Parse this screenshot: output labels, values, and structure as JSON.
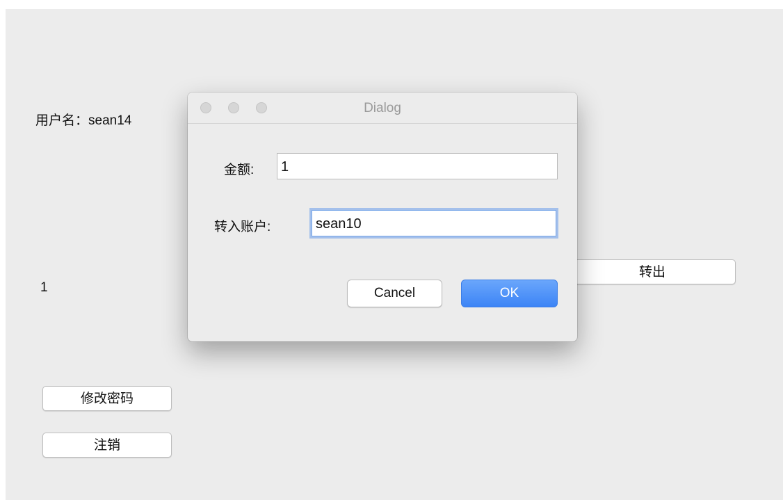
{
  "main": {
    "username_label": "用户名：sean14",
    "value_text": "1",
    "transfer_out_button": "转出",
    "change_password_button": "修改密码",
    "logout_button": "注销"
  },
  "dialog": {
    "title": "Dialog",
    "amount_label": "金额:",
    "amount_value": "1",
    "account_label": "转入账户:",
    "account_value": "sean10",
    "cancel_button": "Cancel",
    "ok_button": "OK"
  },
  "colors": {
    "window_bg": "#ececec",
    "ok_accent": "#3c84f6",
    "focus_ring": "#699ceb"
  }
}
